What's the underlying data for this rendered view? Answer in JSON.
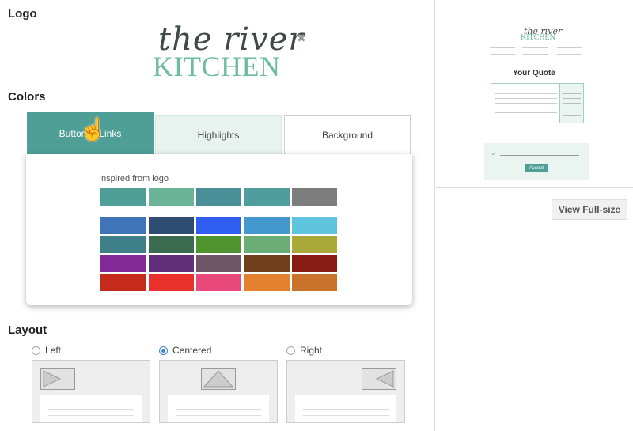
{
  "logo": {
    "title": "Logo",
    "script_text": "the river",
    "brand_text": "KITCHEN",
    "remove_symbol": "✖"
  },
  "colors": {
    "title": "Colors",
    "tabs": [
      {
        "label": "Buttons / Links",
        "active": true
      },
      {
        "label": "Highlights",
        "active": false
      },
      {
        "label": "Background",
        "active": false
      }
    ],
    "palette_caption": "Inspired from logo",
    "logo_swatches": [
      "#4f9f97",
      "#6bb497",
      "#4a8e98",
      "#4f9d9d",
      "#7d7d7d"
    ],
    "swatch_rows": [
      [
        "#3f74b8",
        "#2f4d73",
        "#2f5ef0",
        "#4598ce",
        "#5fc5de"
      ],
      [
        "#3f7f87",
        "#3c6c4f",
        "#4f932f",
        "#6aae75",
        "#a9a939"
      ],
      [
        "#822b98",
        "#62307a",
        "#6e5666",
        "#703e1b",
        "#861c14"
      ],
      [
        "#c52b1c",
        "#e8312d",
        "#e8497a",
        "#e3812e",
        "#c8722c"
      ]
    ],
    "cursor_icon": "☝"
  },
  "layout": {
    "title": "Layout",
    "options": [
      {
        "label": "Left",
        "selected": false
      },
      {
        "label": "Centered",
        "selected": true
      },
      {
        "label": "Right",
        "selected": false
      }
    ]
  },
  "preview": {
    "logo_script": "the river",
    "logo_brand": "KITCHEN",
    "quote_title": "Your Quote",
    "accept_label": "Accept",
    "check_symbol": "✓",
    "view_full_label": "View Full-size"
  }
}
